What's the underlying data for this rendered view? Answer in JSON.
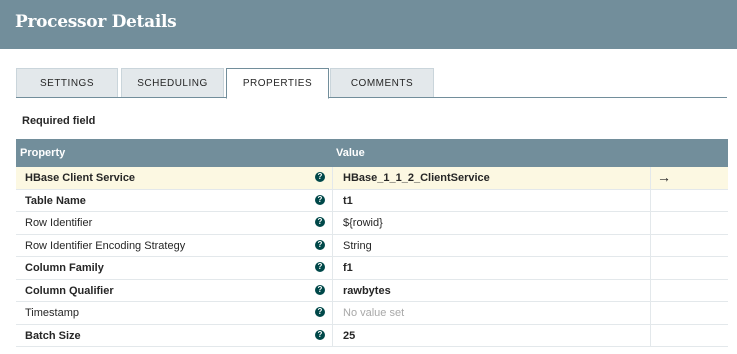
{
  "header": {
    "title": "Processor Details"
  },
  "tabs": [
    {
      "label": "SETTINGS",
      "active": false
    },
    {
      "label": "SCHEDULING",
      "active": false
    },
    {
      "label": "PROPERTIES",
      "active": true
    },
    {
      "label": "COMMENTS",
      "active": false
    }
  ],
  "required_label": "Required field",
  "grid": {
    "columns": {
      "property": "Property",
      "value": "Value"
    },
    "rows": [
      {
        "property": "HBase Client Service",
        "value": "HBase_1_1_2_ClientService",
        "required": true,
        "value_bold": true,
        "has_goto": true,
        "highlighted": true,
        "help_icon": "?"
      },
      {
        "property": "Table Name",
        "value": "t1",
        "required": true,
        "value_bold": true,
        "help_icon": "?"
      },
      {
        "property": "Row Identifier",
        "value": "${rowid}",
        "required": false,
        "value_bold": false,
        "help_icon": "?"
      },
      {
        "property": "Row Identifier Encoding Strategy",
        "value": "String",
        "required": false,
        "value_bold": false,
        "help_icon": "?"
      },
      {
        "property": "Column Family",
        "value": "f1",
        "required": true,
        "value_bold": true,
        "help_icon": "?"
      },
      {
        "property": "Column Qualifier",
        "value": "rawbytes",
        "required": true,
        "value_bold": true,
        "help_icon": "?"
      },
      {
        "property": "Timestamp",
        "value": "No value set",
        "required": false,
        "value_bold": false,
        "unset": true,
        "help_icon": "?"
      },
      {
        "property": "Batch Size",
        "value": "25",
        "required": true,
        "value_bold": true,
        "help_icon": "?"
      }
    ],
    "goto_icon": "→"
  }
}
